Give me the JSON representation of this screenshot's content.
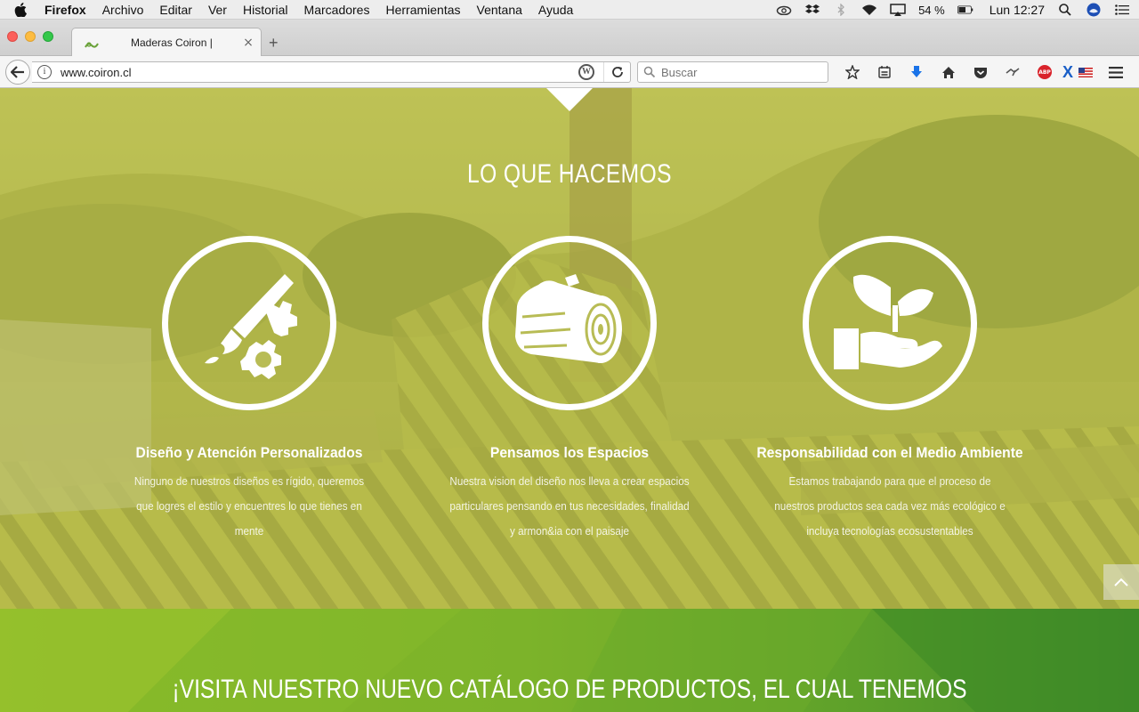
{
  "menubar": {
    "app_name": "Firefox",
    "items": [
      "Archivo",
      "Editar",
      "Ver",
      "Historial",
      "Marcadores",
      "Herramientas",
      "Ventana",
      "Ayuda"
    ],
    "battery": "54 %",
    "clock": "Lun 12:27"
  },
  "tab": {
    "title": "Maderas Coiron |",
    "close": "×",
    "new_tab": "+"
  },
  "navbar": {
    "url": "www.coiron.cl",
    "search_placeholder": "Buscar",
    "abp_label": "ABP"
  },
  "section": {
    "title": "LO QUE HACEMOS"
  },
  "features": [
    {
      "title": "Diseño y Atención Personalizados",
      "description": "Ninguno de nuestros diseños es rígido, queremos que logres el estilo y encuentres lo que tienes en mente",
      "icon": "brush-gear-icon"
    },
    {
      "title": "Pensamos los Espacios",
      "description": "Nuestra vision del diseño nos lleva a crear espacios particulares pensando en tus necesidades, finalidad y armon&ia con el paisaje",
      "icon": "wood-log-icon"
    },
    {
      "title": "Responsabilidad con el Medio Ambiente",
      "description": "Estamos trabajando para que el proceso de nuestros productos sea cada vez más ecológico e incluya tecnologías ecosustentables",
      "icon": "hand-plant-icon"
    }
  ],
  "catalog": {
    "title": "¡VISITA NUESTRO NUEVO CATÁLOGO DE PRODUCTOS, EL CUAL TENEMOS"
  },
  "colors": {
    "hero_tint": "#c8cd46",
    "catalog_green": "#7bb32a",
    "text_white": "#ffffff"
  }
}
